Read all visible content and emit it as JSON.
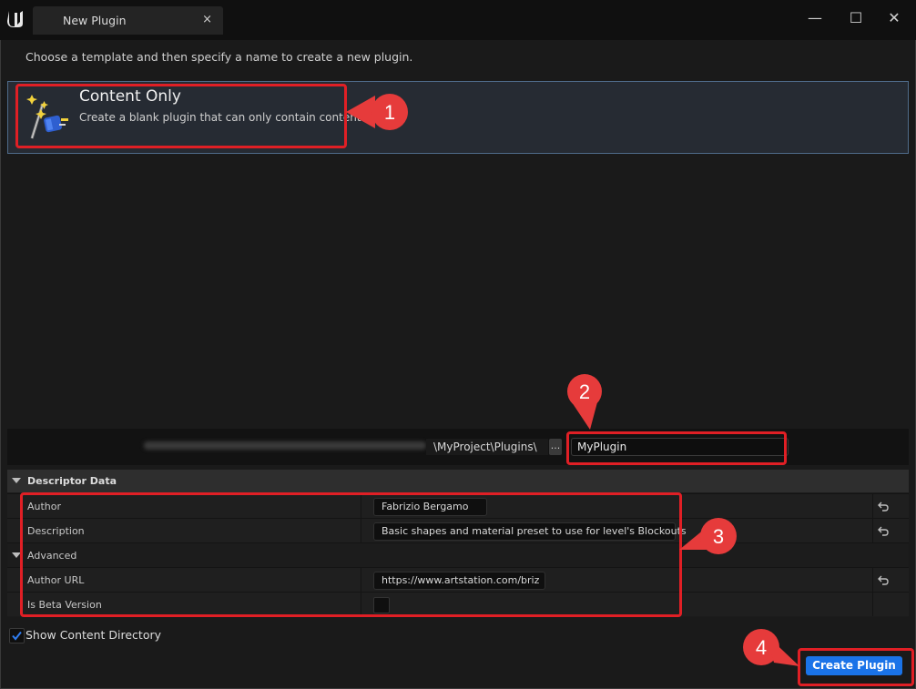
{
  "window": {
    "tab_title": "New Plugin",
    "tab_close": "×",
    "minimize": "—",
    "maximize": "☐",
    "close": "✕"
  },
  "instruction": "Choose a template and then specify a name to create a new plugin.",
  "templates": [
    {
      "name": "Content Only",
      "description": "Create a blank plugin that can only contain content."
    }
  ],
  "path": {
    "visible_suffix": "\\MyProject\\Plugins\\",
    "browse_label": "...",
    "plugin_name": "MyPlugin"
  },
  "descriptor": {
    "section_title": "Descriptor Data",
    "rows": [
      {
        "label": "Author",
        "value": "Fabrizio Bergamo"
      },
      {
        "label": "Description",
        "value": "Basic shapes and material preset to use for level's Blockouts"
      }
    ],
    "advanced": {
      "label": "Advanced",
      "author_url_label": "Author URL",
      "author_url_value": "https://www.artstation.com/briz",
      "beta_label": "Is Beta Version"
    }
  },
  "show_content_label": "Show Content Directory",
  "create_button": "Create Plugin",
  "annotations": [
    "1",
    "2",
    "3",
    "4"
  ],
  "colors": {
    "accent": "#1a73e8",
    "highlight": "#e01f25",
    "selected_border": "#4f6b8a"
  }
}
